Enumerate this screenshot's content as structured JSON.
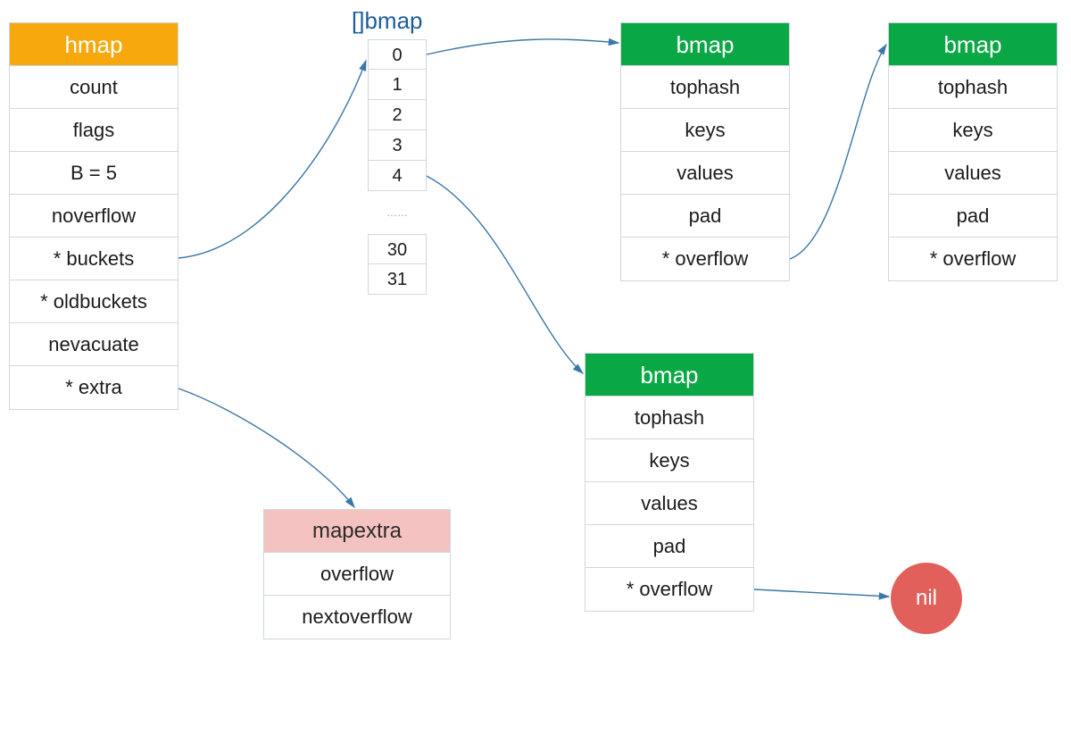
{
  "hmap": {
    "title": "hmap",
    "fields": [
      "count",
      "flags",
      "B = 5",
      "noverflow",
      "* buckets",
      "* oldbuckets",
      "nevacuate",
      "* extra"
    ]
  },
  "array": {
    "label": "[]bmap",
    "items": [
      "0",
      "1",
      "2",
      "3",
      "4",
      "……",
      "30",
      "31"
    ]
  },
  "bmap_template": {
    "title": "bmap",
    "fields": [
      "tophash",
      "keys",
      "values",
      "pad",
      "* overflow"
    ]
  },
  "mapextra": {
    "title": "mapextra",
    "fields": [
      "overflow",
      "nextoverflow"
    ]
  },
  "nil_label": "nil"
}
